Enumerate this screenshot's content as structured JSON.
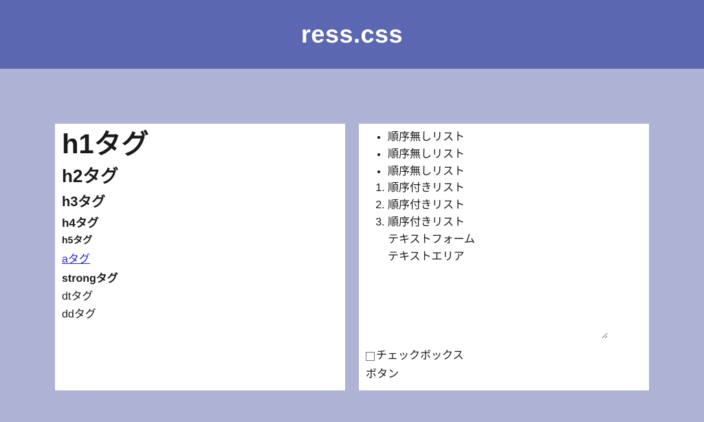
{
  "header": {
    "title": "ress.css"
  },
  "left": {
    "h1": "h1タグ",
    "h2": "h2タグ",
    "h3": "h3タグ",
    "h4": "h4タグ",
    "h5": "h5タグ",
    "a": "aタグ",
    "strong": "strongタグ",
    "dt": "dtタグ",
    "dd": "ddタグ"
  },
  "right": {
    "ul": [
      "順序無しリスト",
      "順序無しリスト",
      "順序無しリスト"
    ],
    "ol": [
      "順序付きリスト",
      "順序付きリスト",
      "順序付きリスト"
    ],
    "textform_label": "テキストフォーム",
    "textarea_label": "テキストエリア",
    "checkbox_label": "チェックボックス",
    "button_label": "ボタン"
  }
}
